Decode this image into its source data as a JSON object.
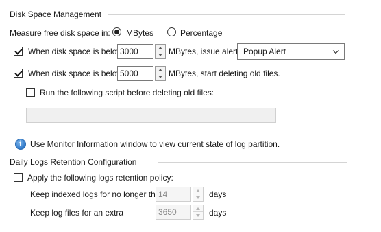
{
  "disk_space": {
    "group_title": "Disk Space Management",
    "measure_label": "Measure free disk space in:",
    "measure_options": {
      "mbytes": "MBytes",
      "percentage": "Percentage"
    },
    "measure_selected": "MBytes",
    "alert": {
      "checked": true,
      "label": "When disk space is below",
      "value": "3000",
      "suffix": "MBytes, issue alert:",
      "alert_type": "Popup Alert"
    },
    "delete": {
      "checked": true,
      "label": "When disk space is below",
      "value": "5000",
      "suffix": "MBytes, start deleting old files."
    },
    "script": {
      "checked": false,
      "label": "Run the following script before deleting old files:",
      "path_value": ""
    }
  },
  "info": {
    "icon": "info-icon",
    "text": "Use Monitor Information window to view current state of log partition."
  },
  "retention": {
    "group_title": "Daily Logs Retention Configuration",
    "apply_checked": false,
    "apply_label": "Apply the following logs retention policy:",
    "indexed": {
      "label": "Keep indexed logs for no longer than",
      "value": "14",
      "unit": "days"
    },
    "extra": {
      "label": "Keep log files for an extra",
      "value": "3650",
      "unit": "days"
    }
  }
}
